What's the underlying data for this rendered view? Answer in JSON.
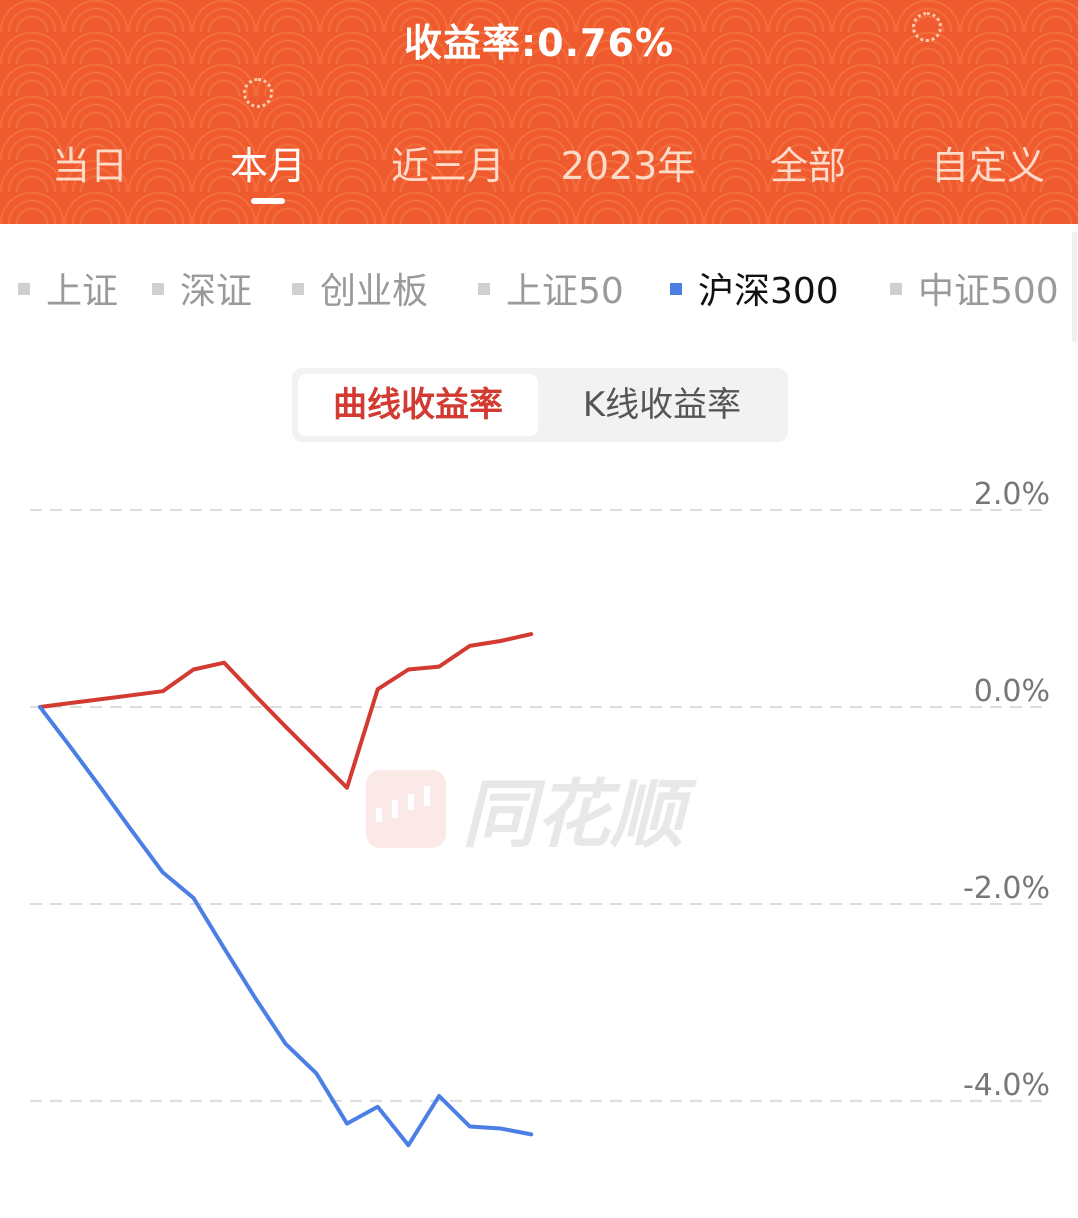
{
  "header": {
    "title": "收益率:0.76%",
    "tabs": [
      {
        "label": "当日"
      },
      {
        "label": "本月",
        "active": true
      },
      {
        "label": "近三月"
      },
      {
        "label": "2023年"
      },
      {
        "label": "全部"
      },
      {
        "label": "自定义"
      }
    ],
    "background_color": "#ef5a2e"
  },
  "indices": [
    {
      "label": "上证"
    },
    {
      "label": "深证"
    },
    {
      "label": "创业板"
    },
    {
      "label": "上证50"
    },
    {
      "label": "沪深300",
      "active": true
    },
    {
      "label": "中证500"
    }
  ],
  "toggle": {
    "curve_label": "曲线收益率",
    "kline_label": "K线收益率",
    "active": "curve"
  },
  "watermark": {
    "text": "同花顺",
    "icon": "candlestick-logo-icon"
  },
  "chart_data": {
    "type": "line",
    "title": "",
    "xlabel": "",
    "ylabel": "",
    "ylim": [
      -4.6,
      2.0
    ],
    "yticks": [
      "2.0%",
      "0.0%",
      "-2.0%",
      "-4.0%"
    ],
    "ytick_values": [
      2.0,
      0.0,
      -2.0,
      -4.0
    ],
    "grid": true,
    "grid_style": "dashed",
    "total_points": 18,
    "series": [
      {
        "color": "#d23a32",
        "values": [
          0.0,
          0.04,
          0.08,
          0.12,
          0.16,
          0.38,
          0.45,
          0.12,
          -0.2,
          -0.51,
          -0.82,
          0.18,
          0.38,
          0.41,
          0.62,
          0.67,
          0.74
        ]
      },
      {
        "color": "#4c7fe6",
        "values": [
          0.0,
          -0.41,
          -0.83,
          -1.26,
          -1.68,
          -1.94,
          -2.45,
          -2.95,
          -3.42,
          -3.72,
          -4.23,
          -4.06,
          -4.45,
          -3.95,
          -4.26,
          -4.28,
          -4.34
        ]
      }
    ]
  }
}
